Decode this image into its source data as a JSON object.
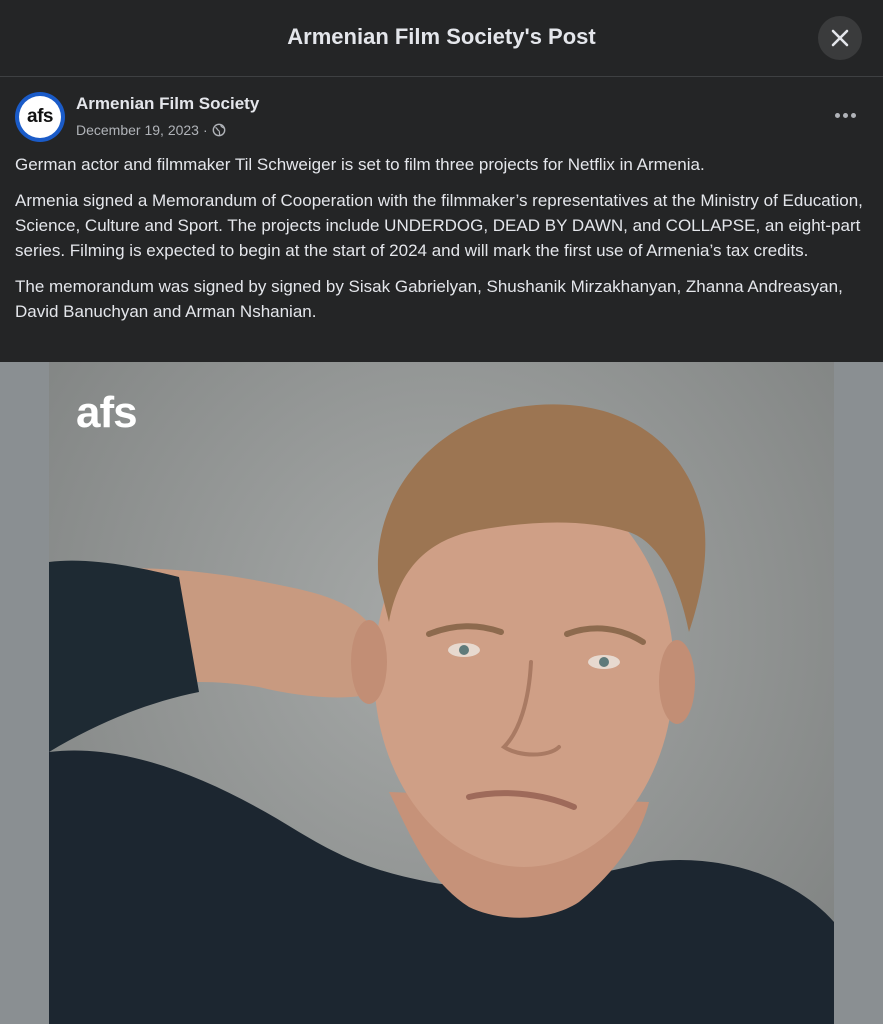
{
  "header": {
    "title": "Armenian Film Society's Post",
    "close_icon": "close-icon"
  },
  "post": {
    "page_name": "Armenian Film Society",
    "avatar_text": "afs",
    "date": "December 19, 2023",
    "separator": "·",
    "privacy_icon": "globe-icon",
    "more_icon": "more-options-icon",
    "paragraphs": [
      "German actor and filmmaker Til Schweiger is set to film three projects for Netflix in Armenia.",
      "Armenia signed a Memorandum of Cooperation with the filmmaker’s representatives at the Ministry of Education, Science, Culture and Sport. The projects include UNDERDOG, DEAD BY DAWN, and COLLAPSE, an eight-part series. Filming is expected to begin at the start of 2024 and will mark the first use of Armenia’s tax credits.",
      "The memorandum was signed by signed by Sisak Gabrielyan, Shushanik Mirzakhanyan, Zhanna Andreasyan, David Banuchyan and Arman Nshanian."
    ]
  },
  "photo": {
    "watermark": "afs",
    "background_color": "#8a8f92"
  },
  "colors": {
    "background": "#242526",
    "text_primary": "#e4e6eb",
    "text_secondary": "#b0b3b8",
    "avatar_ring": "#1a5bc8"
  }
}
